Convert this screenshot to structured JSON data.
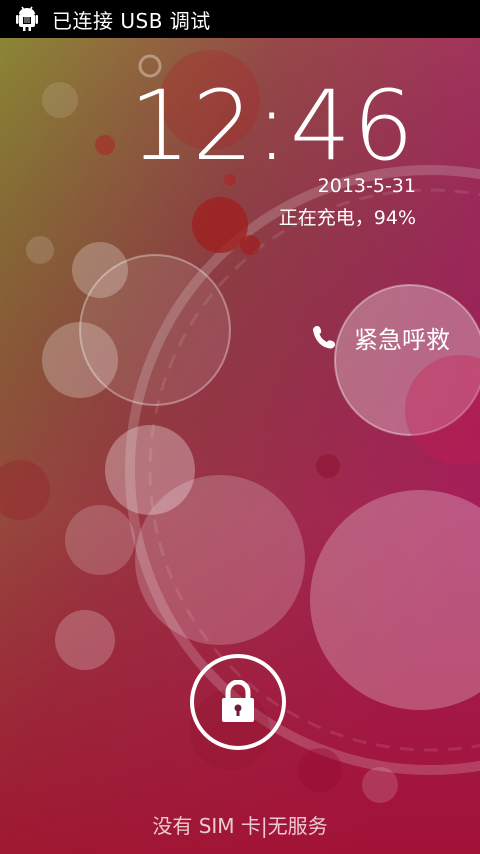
{
  "status_bar": {
    "icon": "usb-debug-android-icon",
    "text": "已连接 USB 调试"
  },
  "lockscreen": {
    "time": "12:46",
    "date": "2013-5-31",
    "charging_status": "正在充电，94%",
    "emergency_call_label": "紧急呼救",
    "emergency_icon": "phone-icon",
    "unlock_icon": "lock-icon",
    "carrier_text": "没有 SIM 卡|无服务"
  },
  "colors": {
    "status_bar_bg": "#000000",
    "text": "#ffffff",
    "wallpaper_top_left": "#8e8c35",
    "wallpaper_right": "#b0236e",
    "wallpaper_bottom": "#a31f3c"
  }
}
